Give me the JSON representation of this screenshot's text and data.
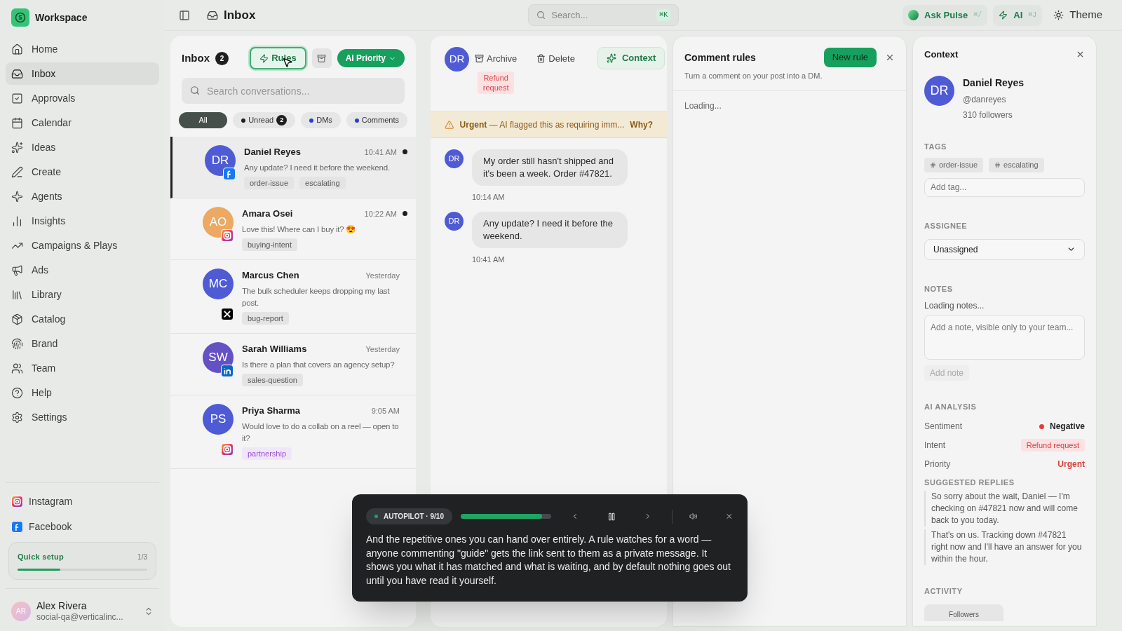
{
  "sidebar": {
    "workspace": "Workspace",
    "items": [
      {
        "label": "Home",
        "selected": false
      },
      {
        "label": "Inbox",
        "selected": true
      },
      {
        "label": "Approvals",
        "selected": false
      },
      {
        "label": "Calendar",
        "selected": false
      },
      {
        "label": "Ideas",
        "selected": false
      },
      {
        "label": "Create",
        "selected": false
      },
      {
        "label": "Agents",
        "selected": false
      },
      {
        "label": "Insights",
        "selected": false
      },
      {
        "label": "Campaigns & Plays",
        "selected": false
      },
      {
        "label": "Ads",
        "selected": false
      },
      {
        "label": "Library",
        "selected": false
      },
      {
        "label": "Catalog",
        "selected": false
      },
      {
        "label": "Brand",
        "selected": false
      },
      {
        "label": "Team",
        "selected": false
      },
      {
        "label": "Help",
        "selected": false
      },
      {
        "label": "Settings",
        "selected": false
      }
    ],
    "accounts": [
      {
        "label": "Instagram",
        "kind": "instagram"
      },
      {
        "label": "Facebook",
        "kind": "facebook"
      }
    ],
    "quick_setup": {
      "label": "Quick setup",
      "count": "1/3",
      "level": 0.33
    },
    "user": {
      "initials": "AR",
      "name": "Alex Rivera",
      "email": "social-qa@verticalinc..."
    }
  },
  "header": {
    "title": "Inbox",
    "search": {
      "placeholder": "Search...",
      "shortcut": "⌘K"
    },
    "actions": [
      {
        "label": "Ask Pulse",
        "shortcut": "⌘/",
        "kind": "pulse"
      },
      {
        "label": "AI",
        "shortcut": "⌘J",
        "kind": "ai"
      },
      {
        "label": "Theme",
        "kind": "theme"
      }
    ]
  },
  "inbox": {
    "title": "Inbox",
    "count": "2",
    "rules_button": "Rules",
    "priority_button": "AI Priority",
    "search": {
      "placeholder": "Search conversations..."
    },
    "filters": [
      {
        "label": "All",
        "selected": true
      },
      {
        "label": "Unread",
        "count": "2",
        "color": "#1f1f1f",
        "selected": false
      },
      {
        "label": "DMs",
        "color": "#2b3fd6",
        "selected": false
      },
      {
        "label": "Comments",
        "color": "#2b3fd6",
        "selected": false
      }
    ],
    "conversations": [
      {
        "initials": "DR",
        "name": "Daniel Reyes",
        "time": "10:41 AM",
        "preview": "Any update? I need it before the weekend.",
        "kind": "facebook",
        "color": "#4f5bd5",
        "unread": true,
        "selected": true,
        "tags": [
          {
            "label": "order-issue",
            "kind": "plain"
          },
          {
            "label": "escalating",
            "kind": "plain"
          }
        ]
      },
      {
        "initials": "AO",
        "name": "Amara Osei",
        "time": "10:22 AM",
        "preview": "Love this! Where can I buy it? 😍",
        "kind": "instagram",
        "color": "#eda862",
        "unread": true,
        "selected": false,
        "tags": [
          {
            "label": "buying-intent",
            "kind": "plain"
          }
        ]
      },
      {
        "initials": "MC",
        "name": "Marcus Chen",
        "time": "Yesterday",
        "preview": "The bulk scheduler keeps dropping my last post.",
        "kind": "x",
        "color": "#4f5bd5",
        "unread": false,
        "selected": false,
        "tags": [
          {
            "label": "bug-report",
            "kind": "plain"
          }
        ]
      },
      {
        "initials": "SW",
        "name": "Sarah Williams",
        "time": "Yesterday",
        "preview": "Is there a plan that covers an agency setup?",
        "kind": "linkedin",
        "color": "#6451c4",
        "unread": false,
        "selected": false,
        "tags": [
          {
            "label": "sales-question",
            "kind": "plain"
          }
        ]
      },
      {
        "initials": "PS",
        "name": "Priya Sharma",
        "time": "9:05 AM",
        "preview": "Would love to do a collab on a reel — open to it?",
        "kind": "instagram",
        "color": "#4f5bd5",
        "unread": false,
        "selected": false,
        "tags": [
          {
            "label": "partnership",
            "kind": "accent"
          }
        ]
      }
    ]
  },
  "conversation": {
    "initials": "DR",
    "archive": "Archive",
    "delete": "Delete",
    "context": "Context",
    "badge": "Refund request",
    "alert": {
      "label": "Urgent",
      "text": "— AI flagged this as requiring imm...",
      "link": "Why?"
    },
    "messages": [
      {
        "initials": "DR",
        "text": "My order still hasn't shipped and it's been a week. Order #47821.",
        "time": "10:14 AM"
      },
      {
        "initials": "DR",
        "text": "Any update? I need it before the weekend.",
        "time": "10:41 AM"
      }
    ]
  },
  "comment_rules": {
    "title": "Comment rules",
    "new_rule": "New rule",
    "subtitle": "Turn a comment on your post into a DM.",
    "status": "Loading..."
  },
  "context": {
    "title": "Context",
    "initials": "DR",
    "name": "Daniel Reyes",
    "handle": "@danreyes",
    "followers": "310 followers",
    "tags_heading": "TAGS",
    "tags": [
      "order-issue",
      "escalating"
    ],
    "tag_placeholder": "Add tag...",
    "assignee_heading": "ASSIGNEE",
    "assignee": "Unassigned",
    "notes_heading": "NOTES",
    "notes_status": "Loading notes...",
    "note_placeholder": "Add a note, visible only to your team...",
    "add_note": "Add note",
    "analysis_heading": "AI ANALYSIS",
    "analysis": [
      {
        "label": "Sentiment",
        "value": "Negative",
        "kind": "dot"
      },
      {
        "label": "Intent",
        "value": "Refund request",
        "kind": "badge"
      },
      {
        "label": "Priority",
        "value": "Urgent",
        "kind": "alert"
      }
    ],
    "replies_heading": "SUGGESTED REPLIES",
    "replies": [
      "So sorry about the wait, Daniel — I'm checking on #47821 now and will come back to you today.",
      "That's on us. Tracking down #47821 right now and I'll have an answer for you within the hour."
    ],
    "activity_heading": "ACTIVITY",
    "activity_tab": "Followers"
  },
  "autopilot": {
    "label": "AUTOPILOT · 9/10",
    "level": 0.9,
    "text": "And the repetitive ones you can hand over entirely. A rule watches for a word — anyone commenting \"guide\" gets the link sent to them as a private message. It shows you what it has matched and what is waiting, and by default nothing goes out until you have read it yourself."
  }
}
